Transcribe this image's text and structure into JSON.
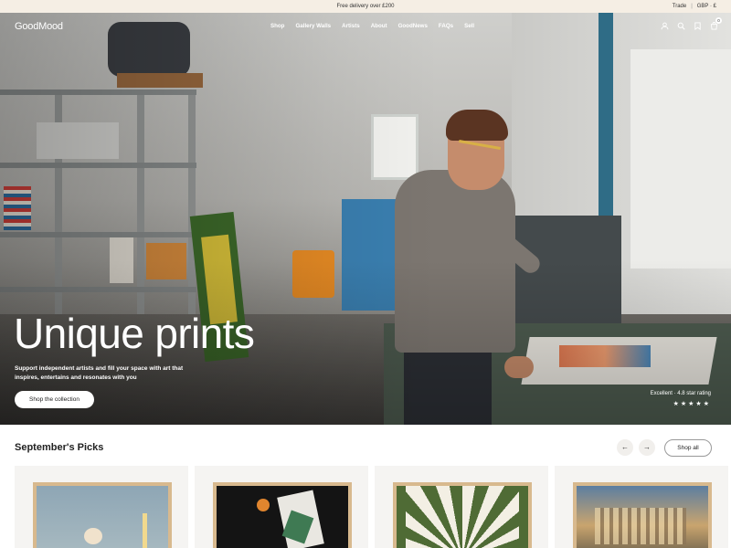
{
  "announcement": {
    "message": "Free delivery over £200",
    "trade": "Trade",
    "separator": "|",
    "currency": "GBP · £"
  },
  "nav": {
    "logo": "GoodMood",
    "items": [
      "Shop",
      "Gallery Walls",
      "Artists",
      "About",
      "GoodNews",
      "FAQs",
      "Sell"
    ],
    "icons": [
      "account-icon",
      "search-icon",
      "wishlist-icon",
      "cart-icon"
    ],
    "cart_count": "0"
  },
  "hero": {
    "title": "Unique prints",
    "subtitle": "Support independent artists and fill your space with art that inspires, entertains and resonates with you",
    "cta": "Shop the collection",
    "rating_text": "Excellent · 4.8 star rating",
    "stars": "★★★★★"
  },
  "picks": {
    "title": "September's Picks",
    "prev": "←",
    "next": "→",
    "shop_all": "Shop all"
  },
  "colors": {
    "announcement_bg": "#f5eee4",
    "text_dark": "#1a1a1a",
    "card_bg": "#f5f4f2",
    "frame_wood": "#d8b98e"
  }
}
